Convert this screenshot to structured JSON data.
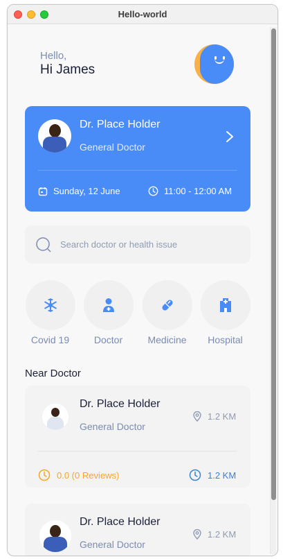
{
  "window": {
    "title": "Hello-world"
  },
  "greeting": {
    "hello": "Hello,",
    "name": "Hi James"
  },
  "appointment": {
    "doctor_name": "Dr. Place Holder",
    "doctor_role": "General Doctor",
    "date": "Sunday, 12 June",
    "time": "11:00 - 12:00 AM"
  },
  "search": {
    "placeholder": "Search doctor or health issue"
  },
  "categories": [
    {
      "label": "Covid 19",
      "icon": "virus-icon"
    },
    {
      "label": "Doctor",
      "icon": "doctor-icon"
    },
    {
      "label": "Medicine",
      "icon": "pill-icon"
    },
    {
      "label": "Hospital",
      "icon": "hospital-icon"
    }
  ],
  "near_doctor": {
    "title": "Near Doctor",
    "cards": [
      {
        "name": "Dr. Place Holder",
        "role": "General Doctor",
        "distance": "1.2 KM",
        "rating": "0.0 (0 Reviews)",
        "time_distance": "1.2 KM"
      },
      {
        "name": "Dr. Place Holder",
        "role": "General Doctor",
        "distance": "1.2 KM"
      }
    ]
  },
  "colors": {
    "primary": "#4a8cf7",
    "accent": "#f7b04a",
    "rating": "#f5a623",
    "link": "#3a82d6"
  }
}
